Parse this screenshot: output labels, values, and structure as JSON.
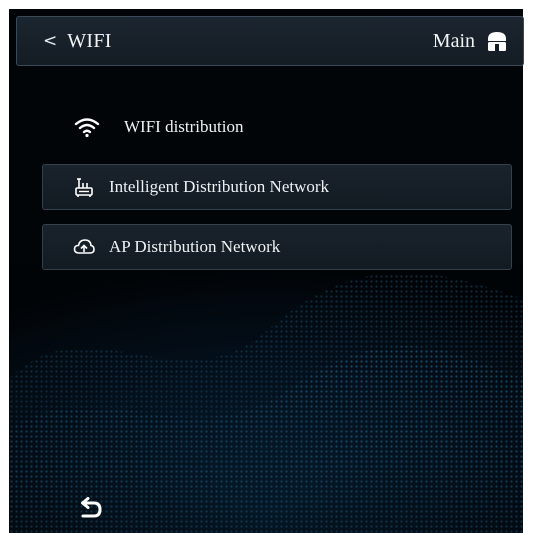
{
  "header": {
    "back_chevron": "<",
    "title": "WIFI",
    "main_label": "Main",
    "main_icon": "home-icon"
  },
  "wifi": {
    "label": "WIFI distribution",
    "icon": "wifi-icon"
  },
  "menu": {
    "items": [
      {
        "label": "Intelligent Distribution Network",
        "icon": "router-icon"
      },
      {
        "label": "AP Distribution Network",
        "icon": "cloud-upload-icon"
      }
    ]
  },
  "footer": {
    "return_icon": "return-arrow-icon"
  },
  "colors": {
    "background": "#020508",
    "wave_accent": "#1b6a9a",
    "panel_border": "#3a4a58",
    "text": "#f0f3f6"
  }
}
